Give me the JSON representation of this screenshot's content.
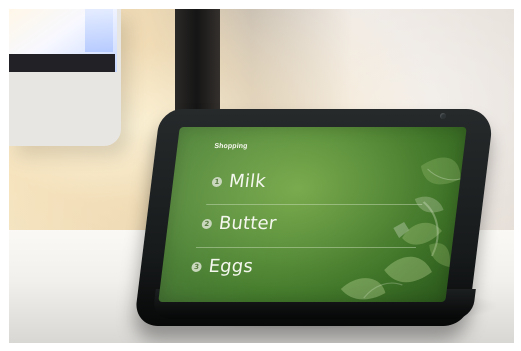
{
  "screen": {
    "title": "Shopping",
    "items": [
      {
        "number": "1",
        "label": "Milk"
      },
      {
        "number": "2",
        "label": "Butter"
      },
      {
        "number": "3",
        "label": "Eggs"
      }
    ]
  },
  "icons": {
    "camera": "camera-icon",
    "leaves": "leaf-decoration-icon"
  },
  "colors": {
    "screen_green": "#5f943c",
    "text": "#f4f7ee",
    "device": "#171a1b"
  }
}
